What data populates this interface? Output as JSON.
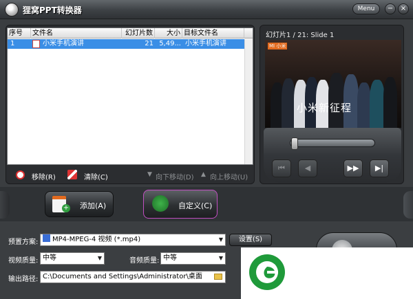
{
  "window": {
    "title": "狸窝PPT转换器",
    "menu_label": "Menu",
    "minimize_icon": "−",
    "close_icon": "×"
  },
  "file_table": {
    "headers": [
      "序号",
      "文件名",
      "幻灯片数",
      "大小",
      "目标文件名"
    ],
    "rows": [
      {
        "index": "1",
        "filename": "小米手机演讲",
        "slides": "21",
        "size": "5,49...",
        "target": "小米手机演讲"
      }
    ]
  },
  "list_toolbar": {
    "remove_label": "移除(R)",
    "clear_label": "清除(C)",
    "move_down_label": "向下移动(D)",
    "move_up_label": "向上移动(U)"
  },
  "preview": {
    "slide_label": "幻灯片1 / 21: Slide 1",
    "slide_caption": "小米新征程",
    "slide_brand": "MI 小米"
  },
  "actions": {
    "add_label": "添加(A)",
    "customize_label": "自定义(C)"
  },
  "settings": {
    "preset_label": "预置方案:",
    "preset_value": "MP4-MPEG-4 视频 (*.mp4)",
    "settings_button": "设置(S)",
    "video_quality_label": "视频质量:",
    "video_quality_value": "中等",
    "audio_quality_label": "音频质量:",
    "audio_quality_value": "中等",
    "output_path_label": "输出路径:",
    "output_path_value": "C:\\Documents and Settings\\Administrator\\桌面"
  },
  "colors": {
    "selection": "#3a8ee6",
    "logo_green": "#1f9a3a",
    "customize_border": "#c24fc2"
  }
}
